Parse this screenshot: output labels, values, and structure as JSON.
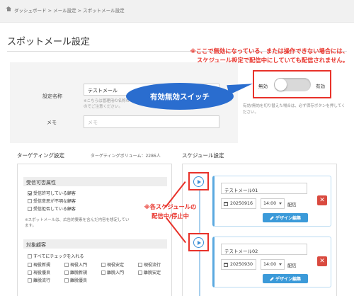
{
  "breadcrumb": {
    "text": "ダッシュボード > メール設定 > スポットメール設定"
  },
  "page_title": "スポットメール設定",
  "form": {
    "name_label": "設定名称",
    "name_value": "テストメール",
    "name_note": "※こちらは管理用の名称の\nのでご注意ください。",
    "memo_label": "メモ",
    "memo_placeholder": "メモ"
  },
  "annotation_top": {
    "line1": "※ここで無効になっている、または操作できない場合には、",
    "line2": "スケジュール設定で配信中にしていても配信されません。"
  },
  "toggle": {
    "off_label": "無効",
    "on_label": "有効",
    "state": "off"
  },
  "toggle_note": "有効/無効を切り替えた場合は、必ず保存ボタンを押してください。",
  "bubble_label": "有効無効スイッチ",
  "targeting": {
    "title": "ターゲティング設定",
    "volume": "ターゲティングボリューム：2286人",
    "group1_title": "受信可否属性",
    "group1_items": [
      {
        "label": "受信許可している顧客",
        "checked": true
      },
      {
        "label": "受信意思が不明な顧客",
        "checked": false
      },
      {
        "label": "受信拒否している顧客",
        "checked": false
      }
    ],
    "group1_note": "※スポットメールは、広告的要素を含んだ内容を想定してい\nます。",
    "group2_title": "対象顧客",
    "check_all": "すべてにチェックを入れる",
    "grid": [
      [
        "現役新規",
        "現役入門",
        "現役安定",
        "現役流行"
      ],
      [
        "現役優良",
        "離脱新規",
        "離脱入門",
        "離脱安定"
      ],
      [
        "離脱流行",
        "離脱優良"
      ]
    ]
  },
  "schedule": {
    "title": "スケジュール設定",
    "cards": [
      {
        "name": "テストメール01",
        "date": "20250916",
        "time": "14:00",
        "action": "配信",
        "design_button": "デザイン編集",
        "delete_icon": "✕"
      },
      {
        "name": "テストメール02",
        "date": "20250930",
        "time": "14:00",
        "action": "配信",
        "design_button": "デザイン編集",
        "delete_icon": "✕"
      }
    ]
  },
  "annotation_schedule": {
    "line1": "※各スケジュールの",
    "line2": "配信中/停止中"
  },
  "colors": {
    "accent_blue": "#3b9ad9",
    "annotation_red": "#e8322a",
    "bubble_blue": "#2a6dcf",
    "delete_red": "#d94a3f"
  }
}
